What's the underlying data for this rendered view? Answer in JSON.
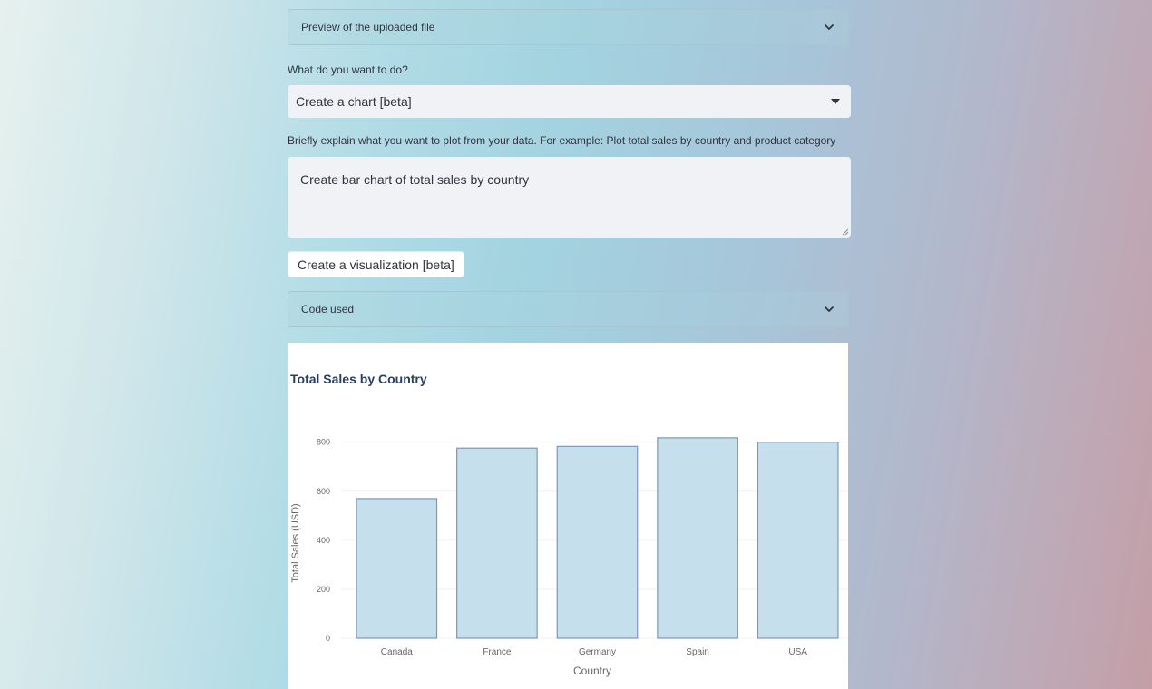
{
  "preview_expander": {
    "label": "Preview of the uploaded file",
    "icon": "chevron-down-icon"
  },
  "action": {
    "label": "What do you want to do?",
    "selected": "Create a chart [beta]",
    "icon": "caret-down-icon"
  },
  "prompt": {
    "label": "Briefly explain what you want to plot from your data. For example: Plot total sales by country and product category",
    "value": "Create bar chart of total sales by country"
  },
  "visualize_button": {
    "label": "Create a visualization [beta]"
  },
  "code_expander": {
    "label": "Code used",
    "icon": "chevron-down-icon"
  },
  "colors": {
    "bar_fill": "#c6dfec",
    "bar_stroke": "#7d97b8",
    "title": "#2a3f5f",
    "grid": "#ebf0f8"
  },
  "chart_data": {
    "type": "bar",
    "title": "Total Sales by Country",
    "xlabel": "Country",
    "ylabel": "Total Sales (USD)",
    "categories": [
      "Canada",
      "France",
      "Germany",
      "Spain",
      "USA"
    ],
    "values": [
      570,
      776,
      783,
      818,
      800
    ],
    "ylim": [
      0,
      836
    ],
    "yticks": [
      0,
      200,
      400,
      600,
      800
    ],
    "grid": true
  }
}
